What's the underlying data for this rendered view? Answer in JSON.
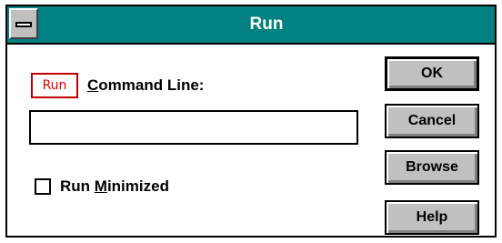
{
  "window": {
    "title": "Run",
    "colors": {
      "titlebar": "#008080",
      "button_face": "#c0c0c0",
      "icon_red": "#e00000"
    }
  },
  "dialog": {
    "icon_text": "Run",
    "command_label_prefix": "",
    "command_label_mnemonic": "C",
    "command_label_rest": "ommand Line:",
    "command_value": "",
    "run_minimized_prefix": "Run ",
    "run_minimized_mnemonic": "M",
    "run_minimized_rest": "inimized",
    "run_minimized_checked": false
  },
  "buttons": {
    "ok": "OK",
    "cancel": "Cancel",
    "browse": "Browse",
    "help": "Help"
  },
  "icons": {
    "system_menu": "system-menu-icon",
    "run": "run-icon"
  }
}
